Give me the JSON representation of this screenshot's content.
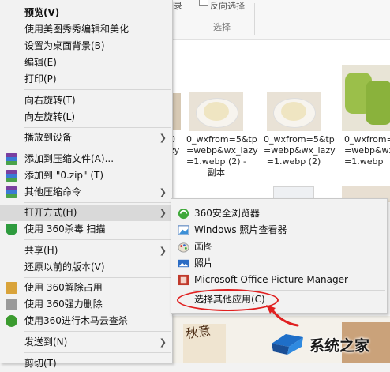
{
  "ribbon": {
    "fragment_1": "录",
    "fragment_2": "反向选择",
    "group_label": "选择"
  },
  "files": [
    {
      "caption": "0_wxfrom=5&tp\n=webp&wx_lazy\n=1.webp (2) -\n副本"
    },
    {
      "caption": "0_wxfrom=5&tp\n=webp&wx_lazy\n=1.webp (2)"
    }
  ],
  "partial_captions": {
    "left": "0\nzy",
    "right": "0_wxfrom=5&tp\n=webp&wx_lazy\n=1.webp"
  },
  "context_menu": {
    "items": [
      {
        "label": "预览(V)",
        "bold": true
      },
      {
        "label": "使用美图秀秀编辑和美化"
      },
      {
        "label": "设置为桌面背景(B)"
      },
      {
        "label": "编辑(E)"
      },
      {
        "label": "打印(P)"
      },
      {
        "label": "向右旋转(T)"
      },
      {
        "label": "向左旋转(L)"
      },
      {
        "label": "播放到设备"
      },
      {
        "label": "添加到压缩文件(A)..."
      },
      {
        "label": "添加到 \"0.zip\" (T)"
      },
      {
        "label": "其他压缩命令"
      },
      {
        "label": "打开方式(H)"
      },
      {
        "label": "使用 360杀毒 扫描"
      },
      {
        "label": "共享(H)"
      },
      {
        "label": "还原以前的版本(V)"
      },
      {
        "label": "使用 360解除占用"
      },
      {
        "label": "使用 360强力删除"
      },
      {
        "label": "使用360进行木马云查杀"
      },
      {
        "label": "发送到(N)"
      },
      {
        "label": "剪切(T)"
      }
    ]
  },
  "open_with_submenu": {
    "items": [
      {
        "label": "360安全浏览器"
      },
      {
        "label": "Windows 照片查看器"
      },
      {
        "label": "画图"
      },
      {
        "label": "照片"
      },
      {
        "label": "Microsoft Office Picture Manager"
      },
      {
        "label": "选择其他应用(C)"
      }
    ]
  },
  "bottom_thumb_text": "秋意",
  "watermark": {
    "text": "系统之家"
  },
  "colors": {
    "menu_bg": "#f2f2f2",
    "highlight": "#d9d9d9",
    "annotation_red": "#e02020"
  }
}
